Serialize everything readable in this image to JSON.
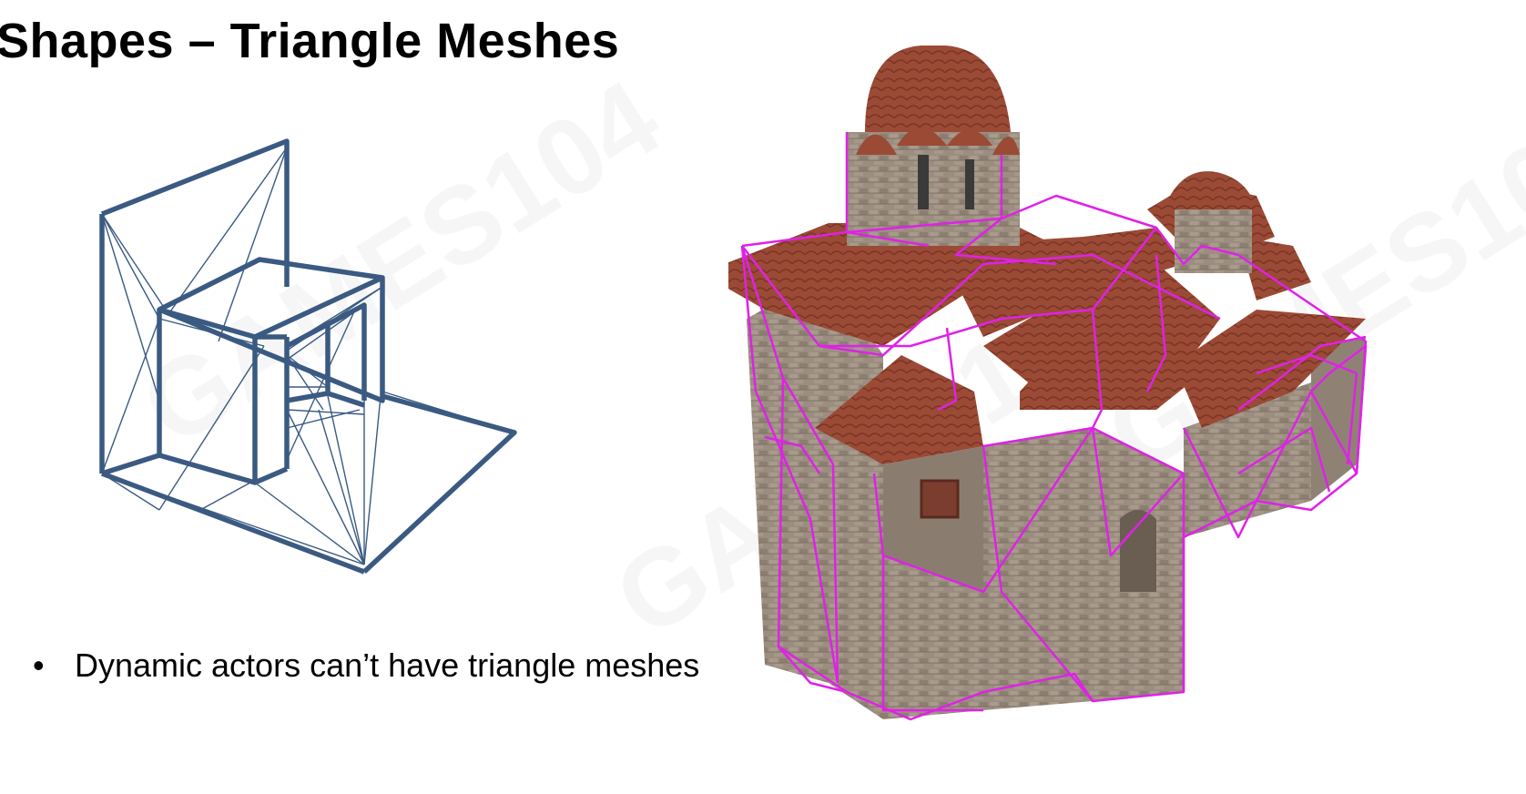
{
  "slide": {
    "title": "Shapes – Triangle Meshes",
    "bullets": [
      {
        "marker": "•",
        "text": "Dynamic actors can’t have triangle meshes"
      }
    ]
  },
  "watermark": {
    "text": "GAMES104"
  },
  "figures": {
    "left": {
      "name": "triangulated-l-shape-wireframe",
      "stroke_color": "#3a5a82"
    },
    "right": {
      "name": "byzantine-church-model-with-collision-mesh",
      "mesh_color": "#e021e8"
    }
  }
}
